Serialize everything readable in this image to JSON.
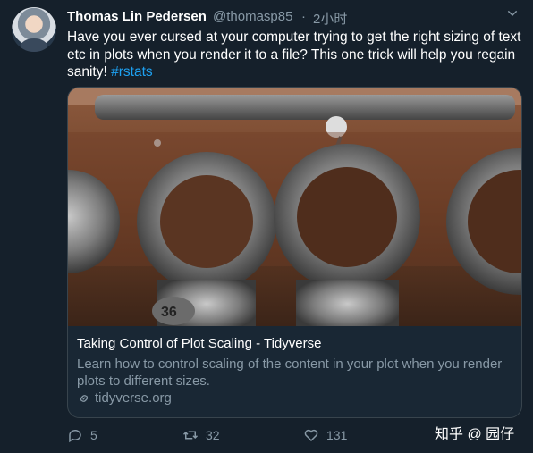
{
  "author": {
    "name": "Thomas Lin Pedersen",
    "handle": "@thomasp85",
    "separator": "·",
    "time": "2小时"
  },
  "tweet": {
    "text": "Have you ever cursed at your computer trying to get the right sizing of text etc in plots when you render it to a file? This one trick will help you regain sanity!",
    "hashtag": "#rstats"
  },
  "card": {
    "title": "Taking Control of Plot Scaling - Tidyverse",
    "description": "Learn how to control scaling of the content in your plot when you render plots to different sizes.",
    "link": "tidyverse.org",
    "image_number": "36"
  },
  "actions": {
    "replies": "5",
    "retweets": "32",
    "likes": "131"
  },
  "watermark": {
    "text": "知乎 @ 园仔"
  },
  "colors": {
    "background": "#15202b",
    "accent": "#1da1f2",
    "muted": "#8899a6",
    "border": "#38444d"
  }
}
